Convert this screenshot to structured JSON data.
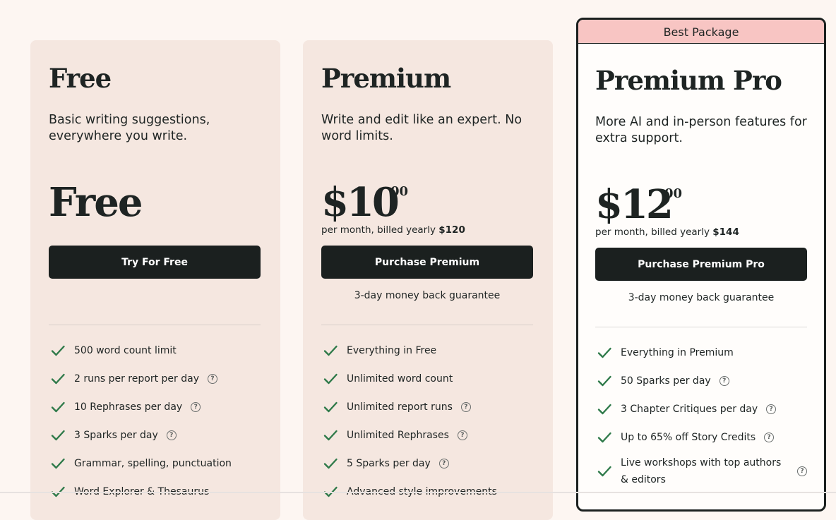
{
  "plans": [
    {
      "name": "Free",
      "description": "Basic writing suggestions, everywhere you write.",
      "price_label": "Free",
      "cta": "Try For Free",
      "features": [
        {
          "text": "500 word count limit",
          "help": false
        },
        {
          "text": "2 runs per report per day",
          "help": true
        },
        {
          "text": "10 Rephrases per day",
          "help": true
        },
        {
          "text": "3 Sparks per day",
          "help": true
        },
        {
          "text": "Grammar, spelling, punctuation",
          "help": false
        },
        {
          "text": "Word Explorer & Thesaurus",
          "help": false
        }
      ]
    },
    {
      "name": "Premium",
      "description": "Write and edit like an expert. No word limits.",
      "price_dollars": "$10",
      "price_cents": "00",
      "billing_prefix": "per month, billed yearly",
      "billing_amount": "$120",
      "cta": "Purchase Premium",
      "guarantee": "3-day money back guarantee",
      "features": [
        {
          "text": "Everything in Free",
          "help": false
        },
        {
          "text": "Unlimited word count",
          "help": false
        },
        {
          "text": "Unlimited report runs",
          "help": true
        },
        {
          "text": "Unlimited Rephrases",
          "help": true
        },
        {
          "text": "5 Sparks per day",
          "help": true
        },
        {
          "text": "Advanced style improvements",
          "help": false
        }
      ]
    },
    {
      "badge": "Best Package",
      "name": "Premium Pro",
      "description": "More AI and in-person features for extra support.",
      "price_dollars": "$12",
      "price_cents": "00",
      "billing_prefix": "per month, billed yearly",
      "billing_amount": "$144",
      "cta": "Purchase Premium Pro",
      "guarantee": "3-day money back guarantee",
      "features": [
        {
          "text": "Everything in Premium",
          "help": false
        },
        {
          "text": "50 Sparks per day",
          "help": true
        },
        {
          "text": "3 Chapter Critiques per day",
          "help": true
        },
        {
          "text": "Up to 65% off Story Credits",
          "help": true
        },
        {
          "text": "Live workshops with top authors & editors",
          "help": true
        }
      ]
    }
  ],
  "icons": {
    "check": "check-icon",
    "help": "question-circle-icon",
    "help_glyph": "?"
  },
  "colors": {
    "card_bg": "#f5e7e0",
    "page_bg": "#fdf6f2",
    "button_bg": "#1b201f",
    "check_green": "#2f7a4a",
    "badge_bg": "#f8c5c3"
  }
}
